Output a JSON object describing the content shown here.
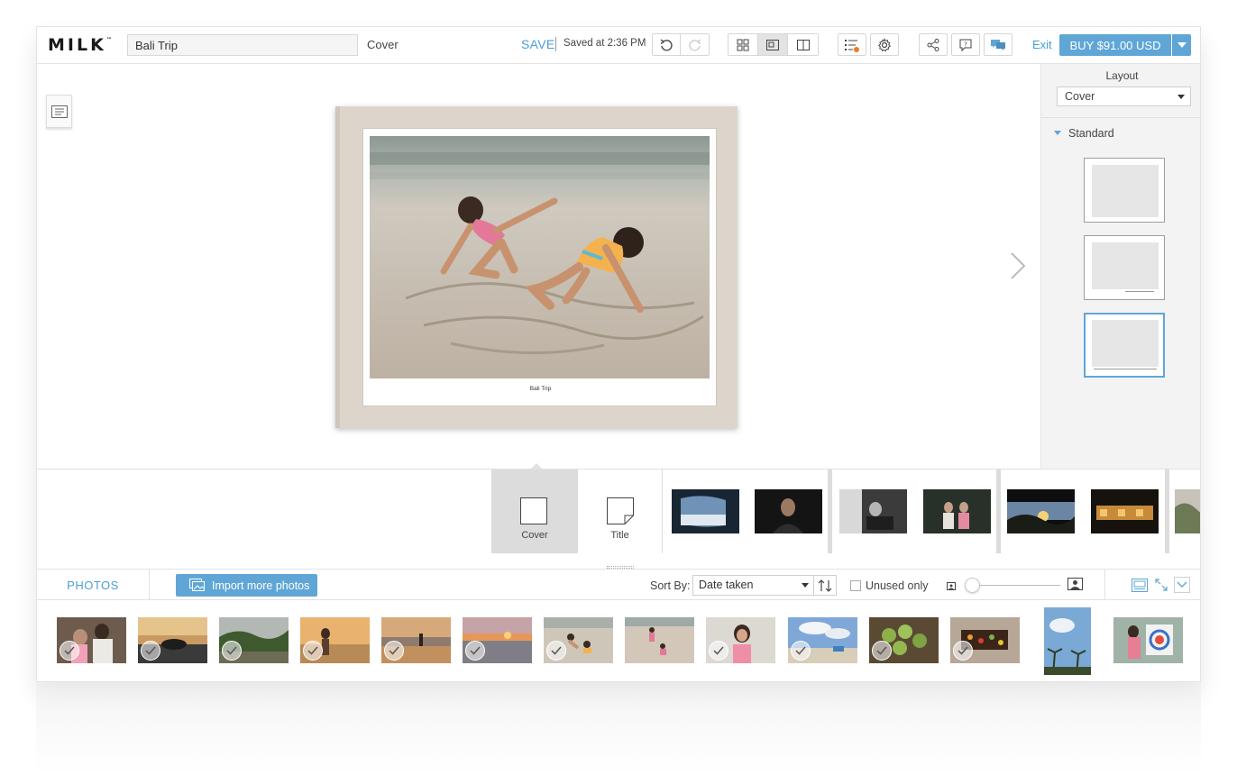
{
  "app": {
    "brand": "MILK",
    "trademark": "™",
    "book_title": "Bali Trip",
    "current_page": "Cover",
    "save_label": "SAVE",
    "saved_status": "Saved at 2:36 PM",
    "exit_label": "Exit",
    "buy_label": "BUY $91.00 USD"
  },
  "toolbar": {
    "icons": [
      "undo-icon",
      "redo-icon",
      "grid-view-icon",
      "page-view-icon",
      "spread-view-icon",
      "checklist-icon",
      "settings-icon",
      "share-icon",
      "help-icon",
      "chat-icon"
    ],
    "active_view": "page-view-icon",
    "notification_color": "#f07c22"
  },
  "cover": {
    "caption": "Bali Trip"
  },
  "layout_panel": {
    "title": "Layout",
    "selected": "Cover",
    "section": "Standard",
    "options": [
      "full-photo",
      "photo-with-caption",
      "photo-with-caption-bordered"
    ],
    "selected_option": 2
  },
  "page_strip": {
    "cover_label": "Cover",
    "title_label": "Title",
    "thumbnails": 7
  },
  "photos_panel": {
    "tab_label": "PHOTOS",
    "import_label": "Import more photos",
    "sort_label": "Sort By:",
    "sort_value": "Date taken",
    "unused_label": "Unused only",
    "unused_checked": false,
    "zoom_level": 0.0
  },
  "photo_tray": {
    "count": 14,
    "checked_count": 12
  },
  "colors": {
    "accent": "#5fa6d6",
    "link": "#4a9fd5",
    "cover_cloth": "#ddd5cc"
  }
}
